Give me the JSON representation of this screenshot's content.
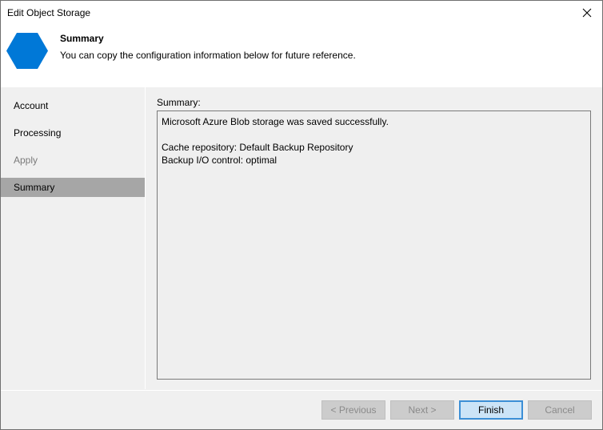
{
  "window": {
    "title": "Edit Object Storage",
    "close_icon": "close-icon"
  },
  "header": {
    "icon": "hexagon-icon",
    "icon_color": "#0078d7",
    "title": "Summary",
    "subtitle": "You can copy the configuration information below for future reference."
  },
  "sidebar": {
    "items": [
      {
        "label": "Account",
        "state": "normal"
      },
      {
        "label": "Processing",
        "state": "normal"
      },
      {
        "label": "Apply",
        "state": "disabled"
      },
      {
        "label": "Summary",
        "state": "active"
      }
    ]
  },
  "content": {
    "label": "Summary:",
    "text": "Microsoft Azure Blob storage was saved successfully.\n\nCache repository: Default Backup Repository\nBackup I/O control: optimal"
  },
  "buttons": {
    "previous": "< Previous",
    "next": "Next >",
    "finish": "Finish",
    "cancel": "Cancel"
  }
}
